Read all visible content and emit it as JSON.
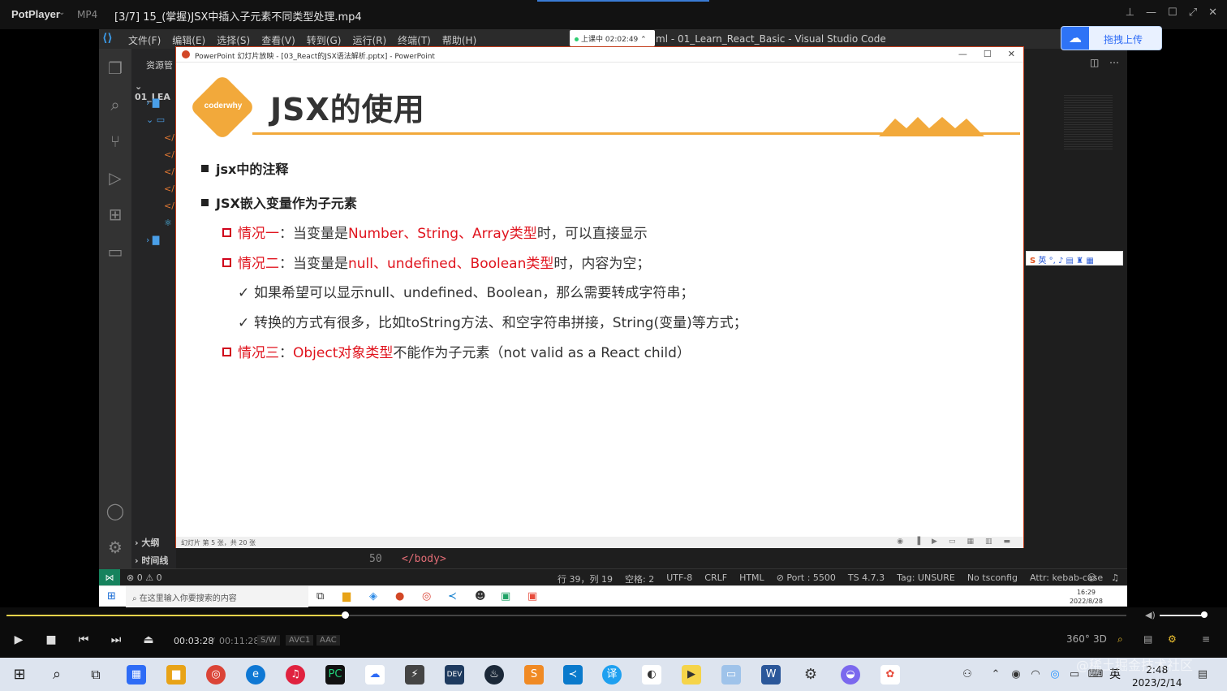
{
  "player": {
    "brand": "PotPlayer",
    "format": "MP4",
    "title": "[3/7] 15_(掌握)JSX中插入子元素不同类型处理.mp4",
    "time_current": "00:03:28",
    "time_separator": "/",
    "time_total": "00:11:28",
    "codecs": [
      "S/W",
      "AVC1",
      "AAC"
    ],
    "progress": 0.302,
    "volume": 0.9
  },
  "vscode": {
    "menu": [
      "文件(F)",
      "编辑(E)",
      "选择(S)",
      "查看(V)",
      "转到(G)",
      "运行(R)",
      "终端(T)",
      "帮助(H)"
    ],
    "window_title": "ml - 01_Learn_React_Basic - Visual Studio Code",
    "recording_badge": "上课中 02:02:49",
    "explorer_header": "资源管",
    "explorer_root": "01_LEA",
    "outline": "大纲",
    "timeline": "时间线",
    "editor_line_no": "50",
    "editor_code": "</body>",
    "status": [
      "行 39，列 19",
      "空格: 2",
      "UTF-8",
      "CRLF",
      "HTML",
      "⊘ Port : 5500",
      "TS 4.7.3",
      "Tag: UNSURE",
      "No tsconfig",
      "Attr: kebab-case"
    ],
    "problems": "⊗ 0 ⚠ 0"
  },
  "upload_button": "拖拽上传",
  "ime": "英",
  "powerpoint": {
    "title": "PowerPoint 幻灯片放映 - [03_React的JSX语法解析.pptx] - PowerPoint",
    "status": "幻灯片 第 5 张，共 20 张"
  },
  "slide": {
    "logo": "coderwhy",
    "title": "JSX的使用",
    "bullet1": "jsx中的注释",
    "bullet2": "JSX嵌入变量作为子元素",
    "case1_label": "情况一",
    "case1_text_a": "：当变量是",
    "case1_red": "Number、String、Array类型",
    "case1_text_b": "时，可以直接显示",
    "case2_label": "情况二",
    "case2_text_a": "：当变量是",
    "case2_red": "null、undefined、Boolean类型",
    "case2_text_b": "时，内容为空；",
    "check1": "如果希望可以显示null、undefined、Boolean，那么需要转成字符串；",
    "check2": "转换的方式有很多，比如toString方法、和空字符串拼接，String(变量)等方式；",
    "case3_label": "情况三",
    "case3_text_a": "：",
    "case3_red": "Object对象类型",
    "case3_text_b": "不能作为子元素（not valid as a React child）"
  },
  "inner_taskbar": {
    "search_placeholder": "在这里输入你要搜索的内容",
    "time": "16:29",
    "date": "2022/8/28"
  },
  "host_taskbar": {
    "ime": "英",
    "time": "2:48",
    "date": "2023/2/14"
  },
  "watermark": "@稀土掘金技术社区"
}
